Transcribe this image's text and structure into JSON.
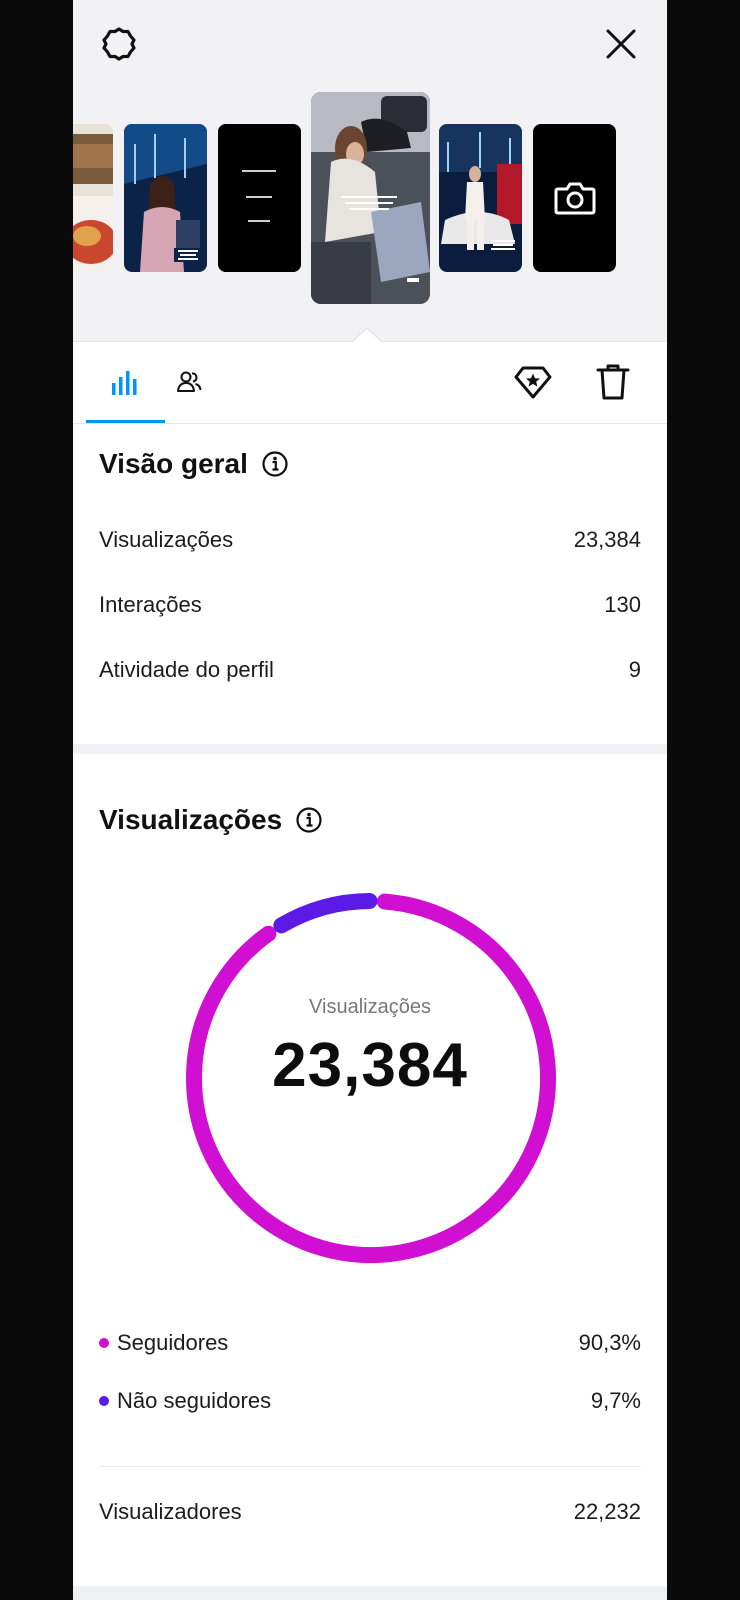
{
  "overview": {
    "title": "Visão geral",
    "rows": [
      {
        "label": "Visualizações",
        "value": "23,384"
      },
      {
        "label": "Interações",
        "value": "130"
      },
      {
        "label": "Atividade do perfil",
        "value": "9"
      }
    ]
  },
  "views": {
    "title": "Visualizações",
    "donut_caption": "Visualizações",
    "total": "23,384",
    "legend": [
      {
        "label": "Seguidores",
        "value": "90,3%",
        "color": "#d10fd2"
      },
      {
        "label": "Não seguidores",
        "value": "9,7%",
        "color": "#5b1ae6"
      }
    ],
    "viewers_label": "Visualizadores",
    "viewers_value": "22,232"
  },
  "chart_data": {
    "type": "pie",
    "categories": [
      "Seguidores",
      "Não seguidores"
    ],
    "values": [
      90.3,
      9.7
    ],
    "colors": [
      "#d10fd2",
      "#5b1ae6"
    ],
    "title": "Visualizações"
  },
  "icons": {
    "settings": "settings-gear-icon",
    "close": "close-icon",
    "tab_insights": "bar-chart-icon",
    "tab_audience": "people-icon",
    "boost": "diamond-star-icon",
    "delete": "trash-icon",
    "camera": "camera-icon",
    "info": "info-icon"
  },
  "colors": {
    "accent": "#0095f6",
    "followers": "#d10fd2",
    "non_followers": "#5b1ae6"
  }
}
